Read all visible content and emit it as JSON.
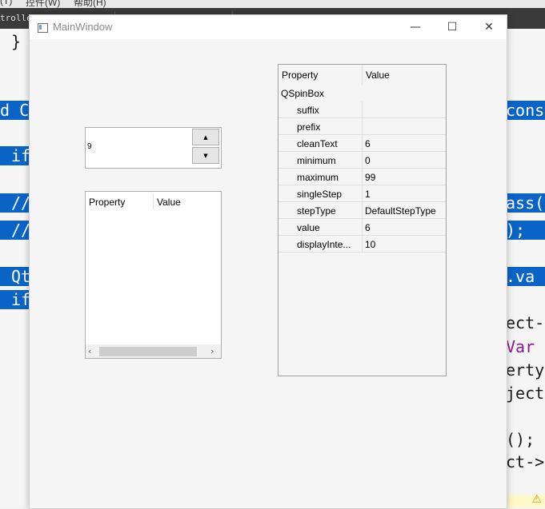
{
  "editor": {
    "menu": [
      "(T)",
      "控件(W)",
      "帮助(H)"
    ],
    "tab_label": "troller",
    "code_lines": {
      "brace": "}",
      "l1_left": "d C",
      "l1_right": "cons",
      "l2_left": "if",
      "l3_left": "//",
      "l3_right": "ass(",
      "l4_left": "//",
      "l4_right": ");",
      "l5_left": "Qt",
      "l5_right": ".va",
      "l6_left": "if",
      "r1": "ect-",
      "r2": "Var",
      "r3": "erty",
      "r4": "ject",
      "r5": "();",
      "r6": "ct->"
    }
  },
  "window": {
    "title": "MainWindow",
    "minimize_glyph": "—",
    "maximize_glyph": "☐",
    "close_glyph": "✕",
    "spinbox": {
      "value": "9",
      "up_arrow": "▲",
      "down_arrow": "▼"
    },
    "property_browser_small": {
      "header_property": "Property",
      "header_value": "Value",
      "scroll_left": "‹",
      "scroll_right": "›"
    },
    "property_browser": {
      "header_property": "Property",
      "header_value": "Value",
      "group": "QSpinBox",
      "rows": [
        {
          "name": "suffix",
          "value": ""
        },
        {
          "name": "prefix",
          "value": ""
        },
        {
          "name": "cleanText",
          "value": "6"
        },
        {
          "name": "minimum",
          "value": "0"
        },
        {
          "name": "maximum",
          "value": "99"
        },
        {
          "name": "singleStep",
          "value": "1"
        },
        {
          "name": "stepType",
          "value": "DefaultStepType"
        },
        {
          "name": "value",
          "value": "6"
        },
        {
          "name": "displayInte...",
          "value": "10"
        }
      ]
    }
  }
}
